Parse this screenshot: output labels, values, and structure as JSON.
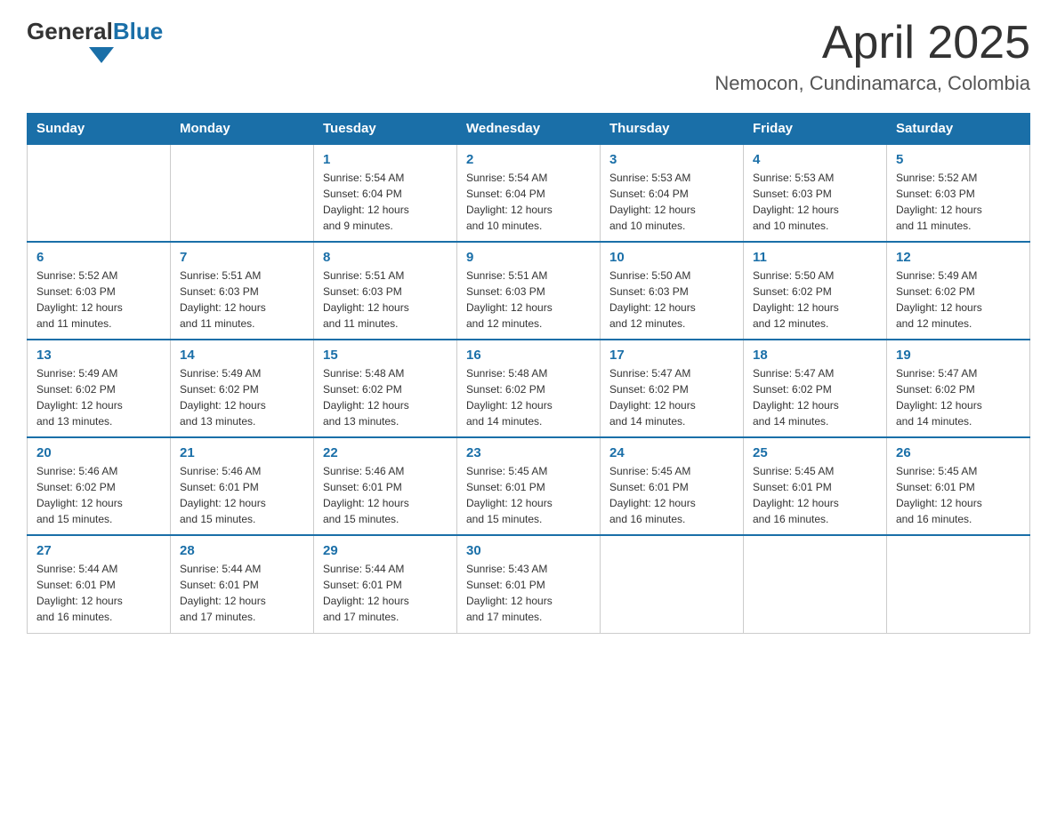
{
  "header": {
    "logo_general": "General",
    "logo_blue": "Blue",
    "month_title": "April 2025",
    "location": "Nemocon, Cundinamarca, Colombia"
  },
  "weekdays": [
    "Sunday",
    "Monday",
    "Tuesday",
    "Wednesday",
    "Thursday",
    "Friday",
    "Saturday"
  ],
  "weeks": [
    [
      {
        "day": "",
        "info": ""
      },
      {
        "day": "",
        "info": ""
      },
      {
        "day": "1",
        "info": "Sunrise: 5:54 AM\nSunset: 6:04 PM\nDaylight: 12 hours\nand 9 minutes."
      },
      {
        "day": "2",
        "info": "Sunrise: 5:54 AM\nSunset: 6:04 PM\nDaylight: 12 hours\nand 10 minutes."
      },
      {
        "day": "3",
        "info": "Sunrise: 5:53 AM\nSunset: 6:04 PM\nDaylight: 12 hours\nand 10 minutes."
      },
      {
        "day": "4",
        "info": "Sunrise: 5:53 AM\nSunset: 6:03 PM\nDaylight: 12 hours\nand 10 minutes."
      },
      {
        "day": "5",
        "info": "Sunrise: 5:52 AM\nSunset: 6:03 PM\nDaylight: 12 hours\nand 11 minutes."
      }
    ],
    [
      {
        "day": "6",
        "info": "Sunrise: 5:52 AM\nSunset: 6:03 PM\nDaylight: 12 hours\nand 11 minutes."
      },
      {
        "day": "7",
        "info": "Sunrise: 5:51 AM\nSunset: 6:03 PM\nDaylight: 12 hours\nand 11 minutes."
      },
      {
        "day": "8",
        "info": "Sunrise: 5:51 AM\nSunset: 6:03 PM\nDaylight: 12 hours\nand 11 minutes."
      },
      {
        "day": "9",
        "info": "Sunrise: 5:51 AM\nSunset: 6:03 PM\nDaylight: 12 hours\nand 12 minutes."
      },
      {
        "day": "10",
        "info": "Sunrise: 5:50 AM\nSunset: 6:03 PM\nDaylight: 12 hours\nand 12 minutes."
      },
      {
        "day": "11",
        "info": "Sunrise: 5:50 AM\nSunset: 6:02 PM\nDaylight: 12 hours\nand 12 minutes."
      },
      {
        "day": "12",
        "info": "Sunrise: 5:49 AM\nSunset: 6:02 PM\nDaylight: 12 hours\nand 12 minutes."
      }
    ],
    [
      {
        "day": "13",
        "info": "Sunrise: 5:49 AM\nSunset: 6:02 PM\nDaylight: 12 hours\nand 13 minutes."
      },
      {
        "day": "14",
        "info": "Sunrise: 5:49 AM\nSunset: 6:02 PM\nDaylight: 12 hours\nand 13 minutes."
      },
      {
        "day": "15",
        "info": "Sunrise: 5:48 AM\nSunset: 6:02 PM\nDaylight: 12 hours\nand 13 minutes."
      },
      {
        "day": "16",
        "info": "Sunrise: 5:48 AM\nSunset: 6:02 PM\nDaylight: 12 hours\nand 14 minutes."
      },
      {
        "day": "17",
        "info": "Sunrise: 5:47 AM\nSunset: 6:02 PM\nDaylight: 12 hours\nand 14 minutes."
      },
      {
        "day": "18",
        "info": "Sunrise: 5:47 AM\nSunset: 6:02 PM\nDaylight: 12 hours\nand 14 minutes."
      },
      {
        "day": "19",
        "info": "Sunrise: 5:47 AM\nSunset: 6:02 PM\nDaylight: 12 hours\nand 14 minutes."
      }
    ],
    [
      {
        "day": "20",
        "info": "Sunrise: 5:46 AM\nSunset: 6:02 PM\nDaylight: 12 hours\nand 15 minutes."
      },
      {
        "day": "21",
        "info": "Sunrise: 5:46 AM\nSunset: 6:01 PM\nDaylight: 12 hours\nand 15 minutes."
      },
      {
        "day": "22",
        "info": "Sunrise: 5:46 AM\nSunset: 6:01 PM\nDaylight: 12 hours\nand 15 minutes."
      },
      {
        "day": "23",
        "info": "Sunrise: 5:45 AM\nSunset: 6:01 PM\nDaylight: 12 hours\nand 15 minutes."
      },
      {
        "day": "24",
        "info": "Sunrise: 5:45 AM\nSunset: 6:01 PM\nDaylight: 12 hours\nand 16 minutes."
      },
      {
        "day": "25",
        "info": "Sunrise: 5:45 AM\nSunset: 6:01 PM\nDaylight: 12 hours\nand 16 minutes."
      },
      {
        "day": "26",
        "info": "Sunrise: 5:45 AM\nSunset: 6:01 PM\nDaylight: 12 hours\nand 16 minutes."
      }
    ],
    [
      {
        "day": "27",
        "info": "Sunrise: 5:44 AM\nSunset: 6:01 PM\nDaylight: 12 hours\nand 16 minutes."
      },
      {
        "day": "28",
        "info": "Sunrise: 5:44 AM\nSunset: 6:01 PM\nDaylight: 12 hours\nand 17 minutes."
      },
      {
        "day": "29",
        "info": "Sunrise: 5:44 AM\nSunset: 6:01 PM\nDaylight: 12 hours\nand 17 minutes."
      },
      {
        "day": "30",
        "info": "Sunrise: 5:43 AM\nSunset: 6:01 PM\nDaylight: 12 hours\nand 17 minutes."
      },
      {
        "day": "",
        "info": ""
      },
      {
        "day": "",
        "info": ""
      },
      {
        "day": "",
        "info": ""
      }
    ]
  ]
}
